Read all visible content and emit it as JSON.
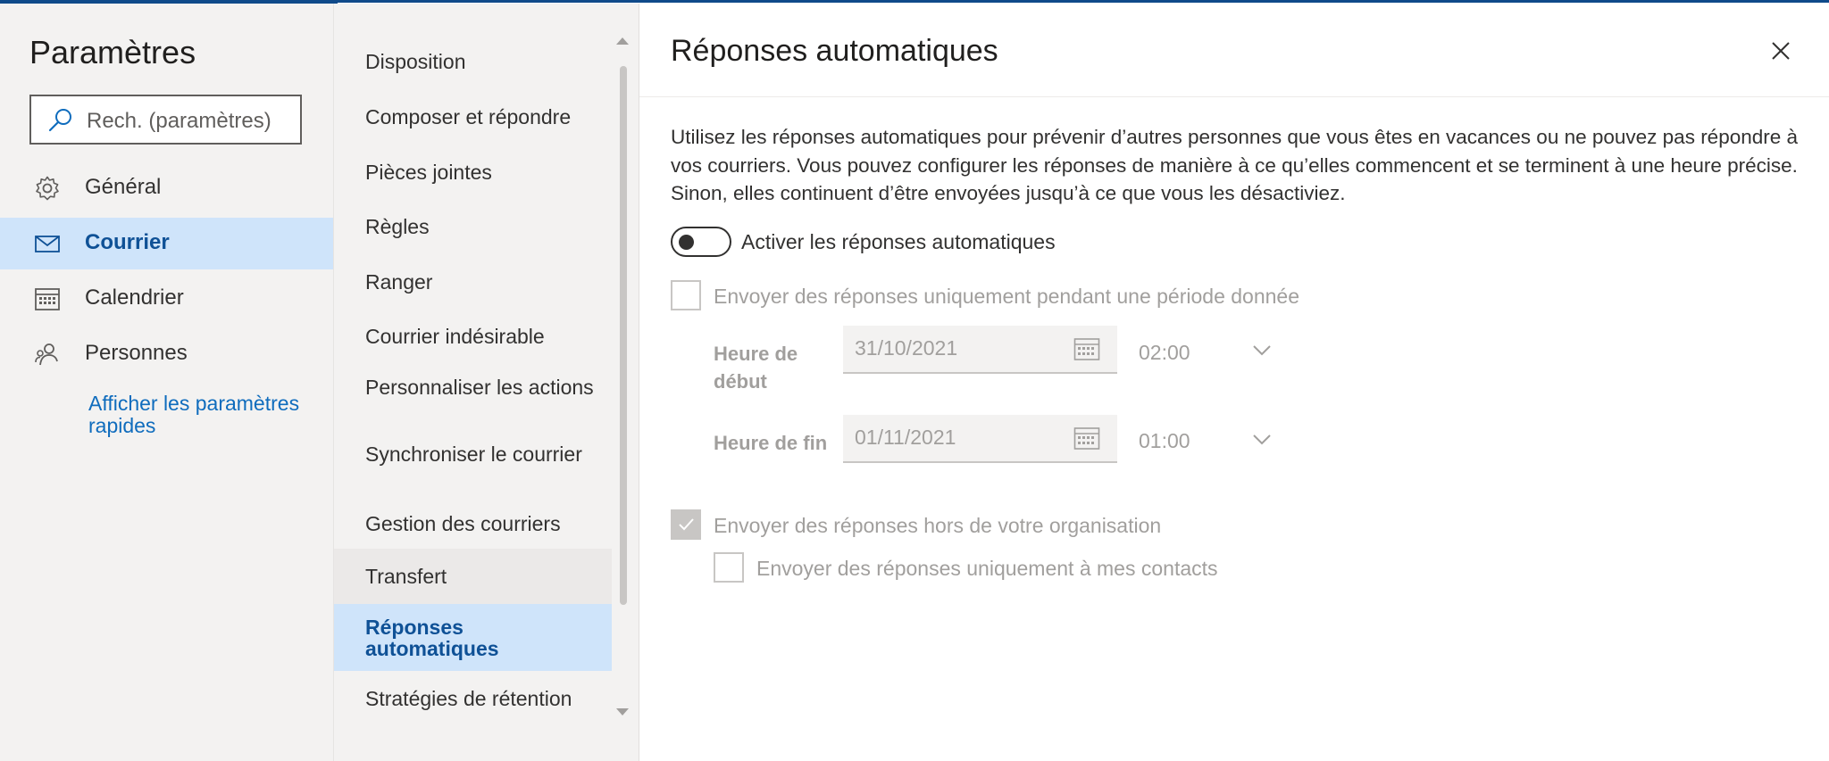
{
  "nav": {
    "title": "Paramètres",
    "search_placeholder": "Rech. (paramètres)",
    "items": [
      {
        "label": "Général",
        "icon": "gear-icon"
      },
      {
        "label": "Courrier",
        "icon": "mail-icon"
      },
      {
        "label": "Calendrier",
        "icon": "calendar-icon"
      },
      {
        "label": "Personnes",
        "icon": "people-icon"
      }
    ],
    "active_item": "Courrier",
    "quick_settings_link": "Afficher les paramètres rapides"
  },
  "submenu": {
    "items": [
      {
        "label": "Disposition"
      },
      {
        "label": "Composer et répondre"
      },
      {
        "label": "Pièces jointes"
      },
      {
        "label": "Règles"
      },
      {
        "label": "Ranger"
      },
      {
        "label": "Courrier indésirable"
      },
      {
        "label": "Personnaliser les actions"
      },
      {
        "label": "Synchroniser le courrier"
      },
      {
        "label": "Gestion des courriers"
      },
      {
        "label": "Transfert"
      },
      {
        "label": "Réponses automatiques"
      },
      {
        "label": "Stratégies de rétention"
      }
    ],
    "hover_item": "Transfert",
    "active_item": "Réponses automatiques"
  },
  "main": {
    "title": "Réponses automatiques",
    "description": "Utilisez les réponses automatiques pour prévenir d’autres personnes que vous êtes en vacances ou ne pouvez pas répondre à vos courriers. Vous pouvez configurer les réponses de manière à ce qu’elles commencent et se terminent à une heure précise. Sinon, elles continuent d’être envoyées jusqu’à ce que vous les désactiviez.",
    "toggle": {
      "label": "Activer les réponses automatiques",
      "on": false
    },
    "period_checkbox": {
      "label": "Envoyer des réponses uniquement pendant une période donnée",
      "checked": false
    },
    "start": {
      "label": "Heure de début",
      "date": "31/10/2021",
      "time": "02:00"
    },
    "end": {
      "label": "Heure de fin",
      "date": "01/11/2021",
      "time": "01:00"
    },
    "outside_org_checkbox": {
      "label": "Envoyer des réponses hors de votre organisation",
      "checked": true
    },
    "contacts_only_checkbox": {
      "label": "Envoyer des réponses uniquement à mes contacts",
      "checked": false
    }
  },
  "colors": {
    "accent": "#0f6cbd",
    "selected_bg": "#cfe4fa",
    "nav_bg": "#f3f2f1",
    "disabled_text": "#a19f9d"
  }
}
